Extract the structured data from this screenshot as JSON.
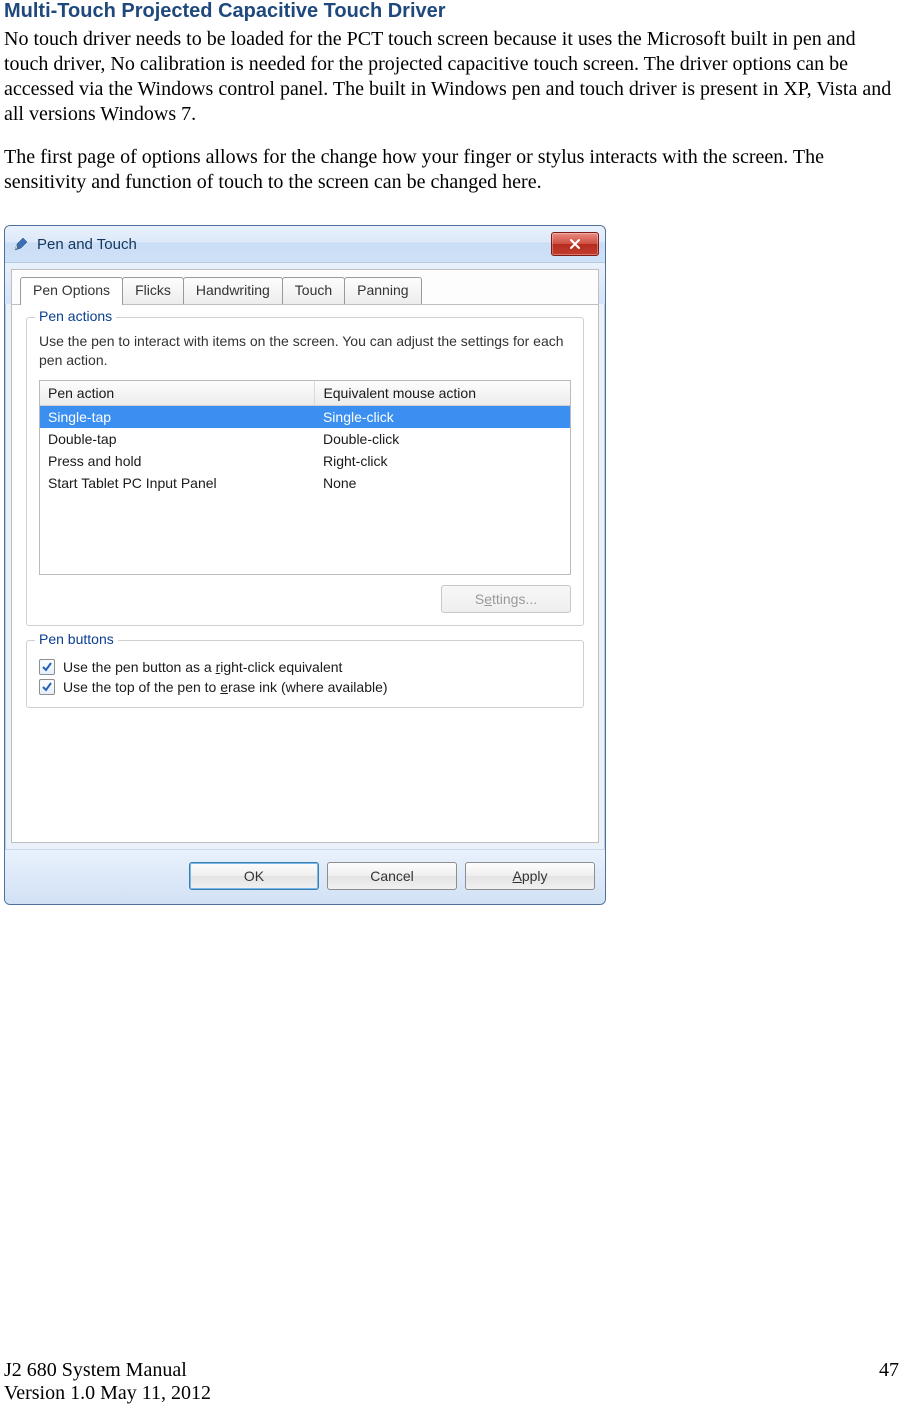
{
  "doc": {
    "heading": "Multi-Touch Projected Capacitive Touch Driver",
    "para1": "No touch driver needs to be loaded for the PCT touch screen because it uses the Microsoft built in pen and touch driver, No calibration is needed for the projected capacitive touch screen. The driver options can be accessed via the Windows control panel. The built in Windows pen and touch driver is present in XP, Vista and all versions Windows 7.",
    "para2": "The first page of options allows for the change how your finger or stylus interacts with the screen. The sensitivity and function of touch to the screen can be changed here."
  },
  "dialog": {
    "title": "Pen and Touch",
    "tabs": {
      "pen_options": "Pen Options",
      "flicks": "Flicks",
      "handwriting": "Handwriting",
      "touch": "Touch",
      "panning": "Panning"
    },
    "pen_actions": {
      "legend": "Pen actions",
      "text": "Use the pen to interact with items on the screen.  You can adjust the settings for each pen action.",
      "col1": "Pen action",
      "col2": "Equivalent mouse action",
      "rows": [
        {
          "a": "Single-tap",
          "b": "Single-click"
        },
        {
          "a": "Double-tap",
          "b": "Double-click"
        },
        {
          "a": "Press and hold",
          "b": "Right-click"
        },
        {
          "a": "Start Tablet PC Input Panel",
          "b": "None"
        }
      ],
      "settings_btn_pre": "S",
      "settings_btn_hot": "e",
      "settings_btn_post": "ttings..."
    },
    "pen_buttons": {
      "legend": "Pen buttons",
      "cb1_pre": "Use the pen button as a ",
      "cb1_hot": "r",
      "cb1_post": "ight-click equivalent",
      "cb2_pre": "Use the top of the pen to ",
      "cb2_hot": "e",
      "cb2_post": "rase ink (where available)"
    },
    "buttons": {
      "ok": "OK",
      "cancel": "Cancel",
      "apply_hot": "A",
      "apply_post": "pply"
    }
  },
  "footer": {
    "left1": "J2 680 System Manual",
    "left2": "Version 1.0 May 11, 2012",
    "page": "47"
  }
}
